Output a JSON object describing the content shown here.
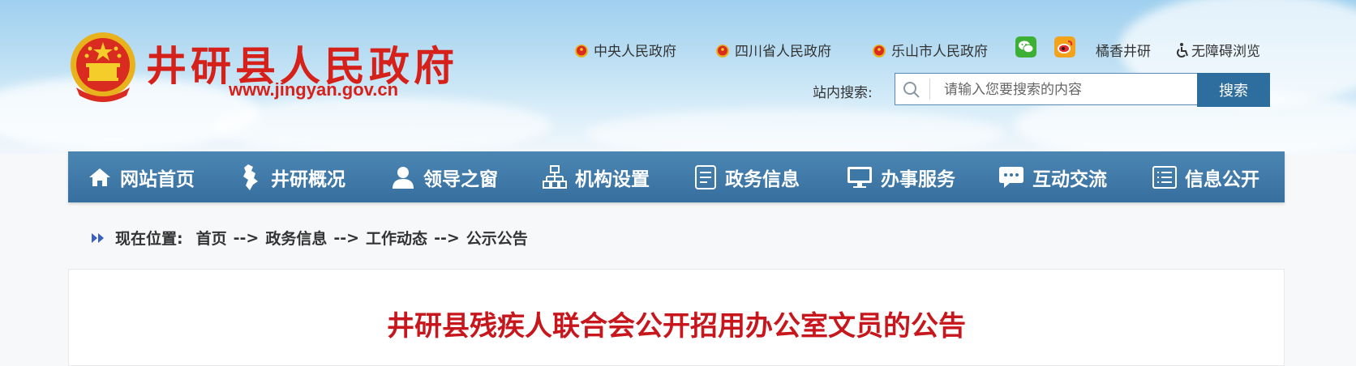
{
  "site": {
    "title": "井研县人民政府",
    "url": "www.jingyan.gov.cn"
  },
  "top_links": [
    {
      "label": "中央人民政府",
      "icon": "emblem-icon"
    },
    {
      "label": "四川省人民政府",
      "icon": "emblem-icon"
    },
    {
      "label": "乐山市人民政府",
      "icon": "emblem-icon"
    }
  ],
  "social": {
    "wechat_icon": "wechat-icon",
    "weibo_icon": "weibo-icon",
    "account_label": "橘香井研",
    "accessibility_label": "无障碍浏览"
  },
  "search": {
    "label": "站内搜索:",
    "placeholder": "请输入您要搜索的内容",
    "button": "搜索"
  },
  "nav": [
    {
      "label": "网站首页",
      "icon": "home-icon"
    },
    {
      "label": "井研概况",
      "icon": "map-icon"
    },
    {
      "label": "领导之窗",
      "icon": "person-icon"
    },
    {
      "label": "机构设置",
      "icon": "org-chart-icon"
    },
    {
      "label": "政务信息",
      "icon": "document-icon"
    },
    {
      "label": "办事服务",
      "icon": "monitor-icon"
    },
    {
      "label": "互动交流",
      "icon": "chat-icon"
    },
    {
      "label": "信息公开",
      "icon": "list-icon"
    }
  ],
  "breadcrumb": {
    "prefix": "现在位置:",
    "items": [
      "首页",
      "政务信息",
      "工作动态",
      "公示公告"
    ],
    "separator": "-->"
  },
  "article": {
    "title": "井研县残疾人联合会公开招用办公室文员的公告"
  },
  "colors": {
    "brand_red": "#d6211b",
    "nav_blue": "#3c77a6",
    "title_red": "#c8161d"
  }
}
